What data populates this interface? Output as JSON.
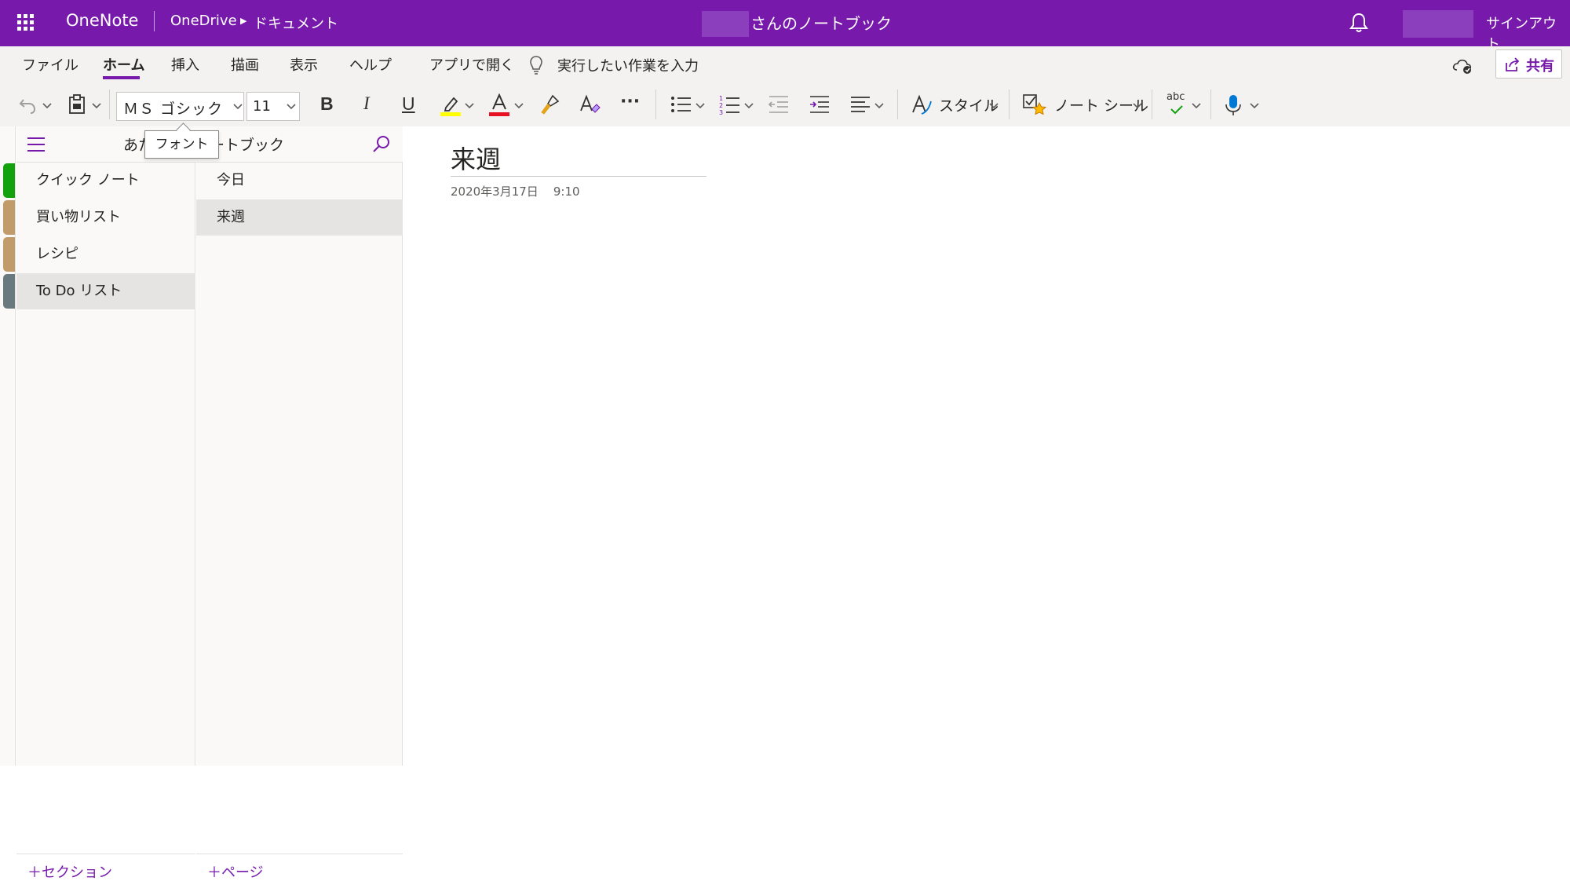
{
  "topbar": {
    "app_name": "OneNote",
    "breadcrumb": [
      "OneDrive",
      "ドキュメント"
    ],
    "notebook_title": "さんのノートブック",
    "signout": "サインアウト",
    "bg_color": "#7719aa"
  },
  "ribbon": {
    "tabs": [
      {
        "label": "ファイル"
      },
      {
        "label": "ホーム",
        "active": true
      },
      {
        "label": "挿入"
      },
      {
        "label": "描画"
      },
      {
        "label": "表示"
      },
      {
        "label": "ヘルプ"
      },
      {
        "label": "アプリで開く"
      }
    ],
    "tell_me": "実行したい作業を入力",
    "share_label": "共有",
    "font_name": "ＭＳ ゴシック",
    "font_size": "11",
    "bold": "B",
    "italic": "I",
    "underline": "U",
    "more": "···",
    "style_label": "スタイル",
    "tag_label": "ノート シール",
    "spell_label": "abc",
    "tooltip": "フォント",
    "icons": [
      "undo-icon",
      "paste-icon",
      "highlight-icon",
      "font-color-icon",
      "format-painter-icon",
      "clear-format-icon",
      "bullets-icon",
      "numbering-icon",
      "outdent-icon",
      "indent-icon",
      "align-icon",
      "style-icon",
      "tag-icon",
      "spelling-icon",
      "dictate-icon",
      "sync-icon",
      "share-icon",
      "lightbulb-icon",
      "bell-icon",
      "waffle-icon",
      "search-icon",
      "hamburger-icon"
    ]
  },
  "navigation": {
    "notebook_name_prefix": "あた",
    "notebook_name_suffix": "ートブック",
    "sections": [
      {
        "label": "クイック ノート",
        "color": "#13a10e"
      },
      {
        "label": "買い物リスト",
        "color": "#c19c6a"
      },
      {
        "label": "レシピ",
        "color": "#c19c6a"
      },
      {
        "label": "To Do リスト",
        "color": "#69797e",
        "selected": true
      }
    ],
    "pages": [
      {
        "label": "今日"
      },
      {
        "label": "来週",
        "selected": true
      }
    ],
    "add_section": "＋セクション",
    "add_page": "＋ページ"
  },
  "page": {
    "title": "来週",
    "date": "2020年3月17日",
    "time": "9:10"
  }
}
